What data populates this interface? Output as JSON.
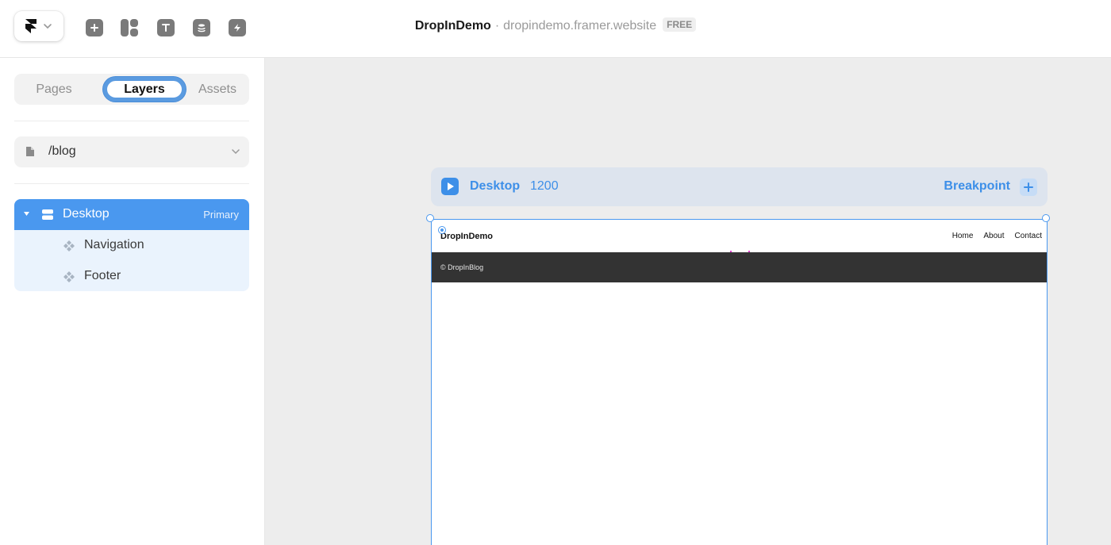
{
  "topbar": {
    "project_name": "DropInDemo",
    "separator": "·",
    "project_url": "dropindemo.framer.website",
    "plan_badge": "FREE",
    "tools": [
      "insert-icon",
      "layout-icon",
      "text-icon",
      "cms-icon",
      "interactions-icon"
    ]
  },
  "left_panel": {
    "tabs": [
      {
        "label": "Pages",
        "active": false
      },
      {
        "label": "Layers",
        "active": true
      },
      {
        "label": "Assets",
        "active": false
      }
    ],
    "page_selector": {
      "label": "/blog"
    },
    "layers": {
      "root": {
        "name": "Desktop",
        "tag": "Primary"
      },
      "children": [
        {
          "name": "Navigation"
        },
        {
          "name": "Footer"
        }
      ]
    }
  },
  "canvas": {
    "breakpoint": {
      "name": "Desktop",
      "width": "1200",
      "add_label": "Breakpoint"
    },
    "site": {
      "logo": "DropInDemo",
      "links": [
        "Home",
        "About",
        "Contact"
      ],
      "footer_text": "© DropInBlog"
    }
  },
  "colors": {
    "accent": "#4a98ef",
    "highlight_ring": "#5b9be0",
    "footer_bg": "#333333",
    "canvas_bg": "#ededed"
  }
}
